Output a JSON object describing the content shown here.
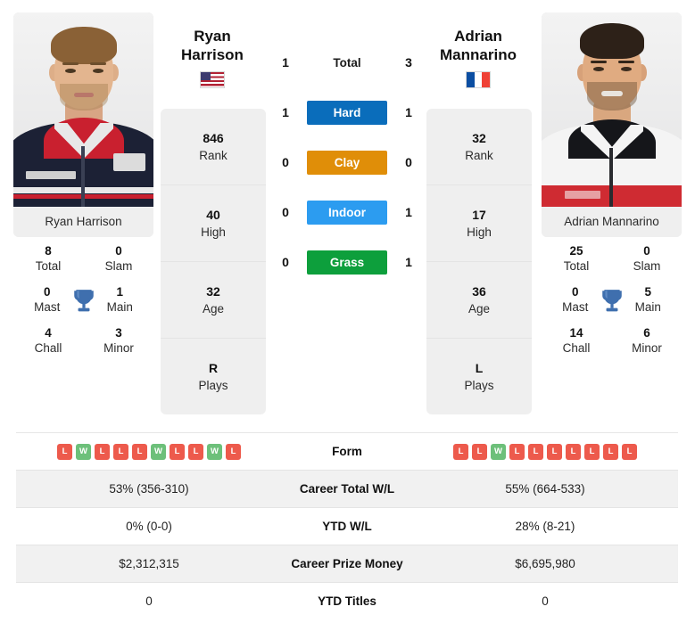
{
  "players": {
    "left": {
      "first_name": "Ryan",
      "last_name": "Harrison",
      "full_name": "Ryan Harrison",
      "flag": "us-flag-icon",
      "rank": "846",
      "rank_label": "Rank",
      "high": "40",
      "high_label": "High",
      "age": "32",
      "age_label": "Age",
      "plays": "R",
      "plays_label": "Plays",
      "titles": {
        "total": "8",
        "total_label": "Total",
        "slam": "0",
        "slam_label": "Slam",
        "mast": "0",
        "mast_label": "Mast",
        "main": "1",
        "main_label": "Main",
        "chall": "4",
        "chall_label": "Chall",
        "minor": "3",
        "minor_label": "Minor"
      },
      "form": [
        "L",
        "W",
        "L",
        "L",
        "L",
        "W",
        "L",
        "L",
        "W",
        "L"
      ],
      "career_total_wl": "53% (356-310)",
      "ytd_wl": "0% (0-0)",
      "career_prize_money": "$2,312,315",
      "ytd_titles": "0"
    },
    "right": {
      "first_name": "Adrian",
      "last_name": "Mannarino",
      "full_name": "Adrian Mannarino",
      "flag": "fr-flag-icon",
      "rank": "32",
      "rank_label": "Rank",
      "high": "17",
      "high_label": "High",
      "age": "36",
      "age_label": "Age",
      "plays": "L",
      "plays_label": "Plays",
      "titles": {
        "total": "25",
        "total_label": "Total",
        "slam": "0",
        "slam_label": "Slam",
        "mast": "0",
        "mast_label": "Mast",
        "main": "5",
        "main_label": "Main",
        "chall": "14",
        "chall_label": "Chall",
        "minor": "6",
        "minor_label": "Minor"
      },
      "form": [
        "L",
        "L",
        "W",
        "L",
        "L",
        "L",
        "L",
        "L",
        "L",
        "L"
      ],
      "career_total_wl": "55% (664-533)",
      "ytd_wl": "28% (8-21)",
      "career_prize_money": "$6,695,980",
      "ytd_titles": "0"
    }
  },
  "head_to_head": [
    {
      "label": "Total",
      "left": "1",
      "right": "3",
      "color": "",
      "style": "plain"
    },
    {
      "label": "Hard",
      "left": "1",
      "right": "1",
      "color": "#0a6dbb",
      "style": "badge"
    },
    {
      "label": "Clay",
      "left": "0",
      "right": "0",
      "color": "#e08e08",
      "style": "badge"
    },
    {
      "label": "Indoor",
      "left": "0",
      "right": "1",
      "color": "#2c9cf0",
      "style": "badge"
    },
    {
      "label": "Grass",
      "left": "0",
      "right": "1",
      "color": "#0d9f3c",
      "style": "badge"
    }
  ],
  "table_rows": [
    {
      "label": "Form",
      "type": "form",
      "stripe": false
    },
    {
      "label": "Career Total W/L",
      "type": "text",
      "stripe": true,
      "key": "career_total_wl"
    },
    {
      "label": "YTD W/L",
      "type": "text",
      "stripe": false,
      "key": "ytd_wl"
    },
    {
      "label": "Career Prize Money",
      "type": "text",
      "stripe": true,
      "key": "career_prize_money"
    },
    {
      "label": "YTD Titles",
      "type": "text",
      "stripe": false,
      "key": "ytd_titles"
    }
  ],
  "colors": {
    "hard": "#0a6dbb",
    "clay": "#e08e08",
    "indoor": "#2c9cf0",
    "grass": "#0d9f3c",
    "win": "#6dc07a",
    "loss": "#ed5a4c",
    "card_bg": "#efefef",
    "stripe_bg": "#f1f1f1",
    "trophy": "#3f6fae"
  }
}
